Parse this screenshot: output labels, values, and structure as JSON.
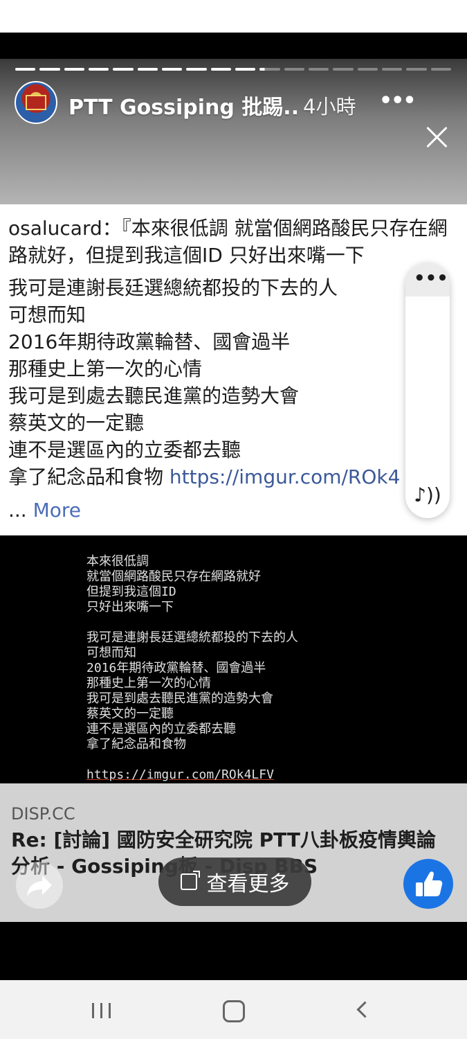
{
  "story": {
    "page_name": "PTT Gossiping 批踢...",
    "time": "4小時",
    "more_icon": "more-horizontal-icon",
    "close_icon": "close-icon",
    "progress": {
      "segments_total": 18,
      "segments_full": 10,
      "partial_fraction": 0.25
    }
  },
  "post": {
    "lead_text": "osalucard：『本來很低調 就當個網路酸民只存在網路就好，但提到我這個ID 只好出來嘴一下",
    "lines": [
      "我可是連謝長廷選總統都投的下去的人",
      "可想而知",
      "2016年期待政黨輪替、國會過半",
      "那種史上第一次的心情",
      "我可是到處去聽民進黨的造勢大會",
      "蔡英文的一定聽",
      "連不是選區內的立委都去聽"
    ],
    "last_line_text": "拿了紀念品和食物 ",
    "last_line_link": "https://imgur.com/ROk4",
    "ellipsis": "... ",
    "more_label": "More"
  },
  "side_controls": {
    "dots": "•••",
    "music": "♪))"
  },
  "terminal": {
    "lines": [
      "本來很低調",
      "就當個網路酸民只存在網路就好",
      "但提到我這個ID",
      "只好出來嘴一下",
      "",
      "我可是連謝長廷選總統都投的下去的人",
      "可想而知",
      "2016年期待政黨輪替、國會過半",
      "那種史上第一次的心情",
      "我可是到處去聽民進黨的造勢大會",
      "蔡英文的一定聽",
      "連不是選區內的立委都去聽",
      "拿了紀念品和食物",
      ""
    ],
    "link": "https://imgur.com/ROk4LFV"
  },
  "link_preview": {
    "domain": "DISP.CC",
    "title": "Re: [討論] 國防安全研究院 PTT八卦板疫情輿論分析 - Gossiping板 - Disp BBS"
  },
  "actions": {
    "see_more_label": "查看更多",
    "share_icon": "share-icon",
    "like_icon": "thumbs-up-icon",
    "external_icon": "external-link-icon"
  },
  "colors": {
    "like_blue": "#1b74e4",
    "link_blue": "#3b5998",
    "more_blue": "#4b6cb7"
  },
  "nav": {
    "recent_icon": "recent-apps-icon",
    "home_icon": "home-icon",
    "back_icon": "back-icon"
  }
}
